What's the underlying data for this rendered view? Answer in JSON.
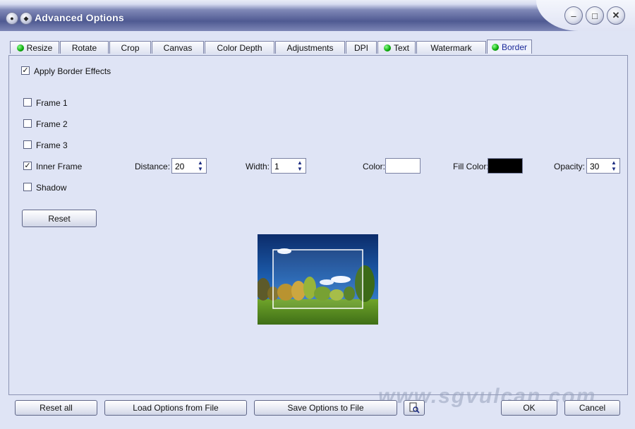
{
  "window": {
    "title": "Advanced Options"
  },
  "tabs": [
    {
      "label": "Resize",
      "dot": true
    },
    {
      "label": "Rotate",
      "dot": false
    },
    {
      "label": "Crop",
      "dot": false
    },
    {
      "label": "Canvas",
      "dot": false
    },
    {
      "label": "Color Depth",
      "dot": false
    },
    {
      "label": "Adjustments",
      "dot": false
    },
    {
      "label": "DPI",
      "dot": false
    },
    {
      "label": "Text",
      "dot": true
    },
    {
      "label": "Watermark",
      "dot": false
    },
    {
      "label": "Border",
      "dot": true,
      "active": true
    }
  ],
  "border": {
    "apply_label": "Apply Border Effects",
    "apply_checked": true,
    "frames": [
      {
        "label": "Frame 1",
        "checked": false
      },
      {
        "label": "Frame 2",
        "checked": false
      },
      {
        "label": "Frame 3",
        "checked": false
      },
      {
        "label": "Inner Frame",
        "checked": true
      },
      {
        "label": "Shadow",
        "checked": false
      }
    ],
    "distance_label": "Distance:",
    "distance_value": "20",
    "width_label": "Width:",
    "width_value": "1",
    "color_label": "Color:",
    "color_value": "#ffffff",
    "fill_color_label": "Fill Color:",
    "fill_color_value": "#000000",
    "opacity_label": "Opacity:",
    "opacity_value": "30",
    "reset_label": "Reset"
  },
  "footer": {
    "reset_all": "Reset all",
    "load": "Load Options from File",
    "save": "Save Options to File",
    "ok": "OK",
    "cancel": "Cancel"
  },
  "watermark_text": "www.sgvulcan.com"
}
